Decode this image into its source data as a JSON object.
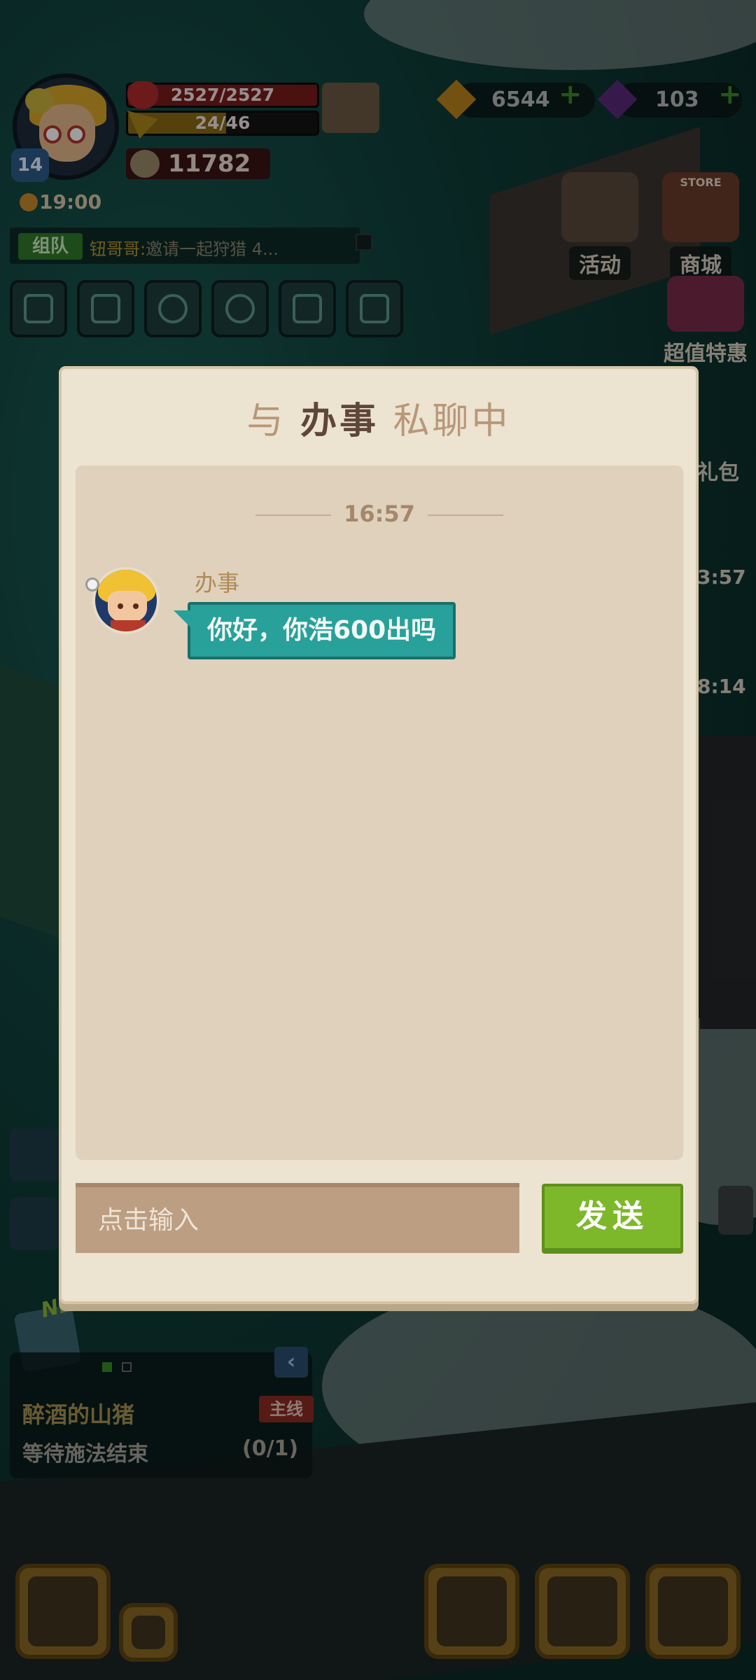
{
  "player": {
    "level": "14",
    "hp": "2527/2527",
    "exp": "24/46",
    "power": "11782",
    "clock": "19:00"
  },
  "team": {
    "tag": "组队",
    "nickname": "钮哥哥:",
    "message": "邀请一起狩猎 4..."
  },
  "currency": {
    "gold": "6544",
    "diamond": "103"
  },
  "side_buttons": {
    "activity": "活动",
    "store_sign": "STORE",
    "store": "商城",
    "deals": "超值特惠",
    "gift": "礼包",
    "timer1": "3:57",
    "timer2": "8:14"
  },
  "quest": {
    "new_tag": "NEW",
    "title": "醉酒的山猪",
    "tag": "主线",
    "desc": "等待施法结束",
    "count": "(0/1)"
  },
  "dialog": {
    "title_prefix": "与",
    "partner": "办事",
    "title_suffix": "私聊中",
    "time": "16:57",
    "messages": [
      {
        "sender": "办事",
        "text": "你好，你浩600出吗"
      }
    ],
    "input_placeholder": "点击输入",
    "send_label": "发送"
  },
  "colors": {
    "bubble": "#27a19a",
    "send_button": "#7db82b",
    "dialog_bg": "#ece3d1",
    "chat_bg": "#dfd1bc"
  },
  "icons": [
    "avatar",
    "help-book-icon",
    "gold-gem-icon",
    "purple-diamond-icon",
    "plus-icon",
    "fullscreen-icon",
    "mail-icon",
    "friends-icon",
    "chat-icon",
    "map-icon",
    "task-board-icon",
    "home-icon",
    "location-icon",
    "hammer-icon",
    "camera-icon",
    "back-arrow-icon"
  ]
}
